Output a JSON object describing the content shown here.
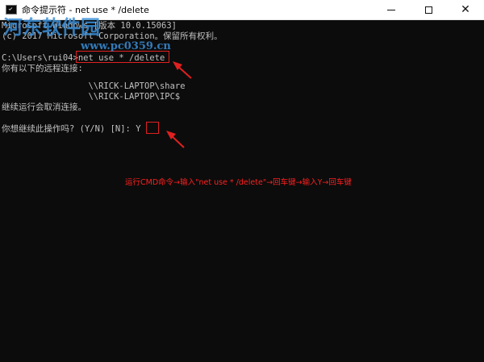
{
  "window": {
    "title": "命令提示符 - net  use * /delete",
    "controls": {
      "minimize": "—",
      "maximize": "□",
      "close": "✕"
    }
  },
  "console": {
    "lines": [
      "Microsoft Windows [版本 10.0.15063]",
      "(c) 2017 Microsoft Corporation。保留所有权利。",
      "",
      "C:\\Users\\rui04>net use * /delete",
      "你有以下的远程连接:",
      "",
      "                 \\\\RICK-LAPTOP\\share",
      "                 \\\\RICK-LAPTOP\\IPC$",
      "继续运行会取消连接。",
      "",
      "你想继续此操作吗? (Y/N) [N]: Y"
    ],
    "prompt_path": "C:\\Users\\rui04>",
    "typed_command": "net use * /delete",
    "confirm_prompt": "你想继续此操作吗? (Y/N) [N]: ",
    "confirm_answer": "Y"
  },
  "watermark": {
    "line1": "河东软件园",
    "line2": "www.pc0359.cn"
  },
  "annotation": {
    "text": "运行CMD命令→输入\"net use * /delete\"→回车键→输入Y→回车键"
  },
  "colors": {
    "background": "#0c0c0c",
    "text": "#c0c0c0",
    "annotation": "#ff2020",
    "watermark": "#3a8fd8",
    "titlebar": "#ffffff"
  },
  "icons": [
    "cmd-app-icon",
    "minimize-icon",
    "maximize-icon",
    "close-icon",
    "red-arrow-icon"
  ]
}
